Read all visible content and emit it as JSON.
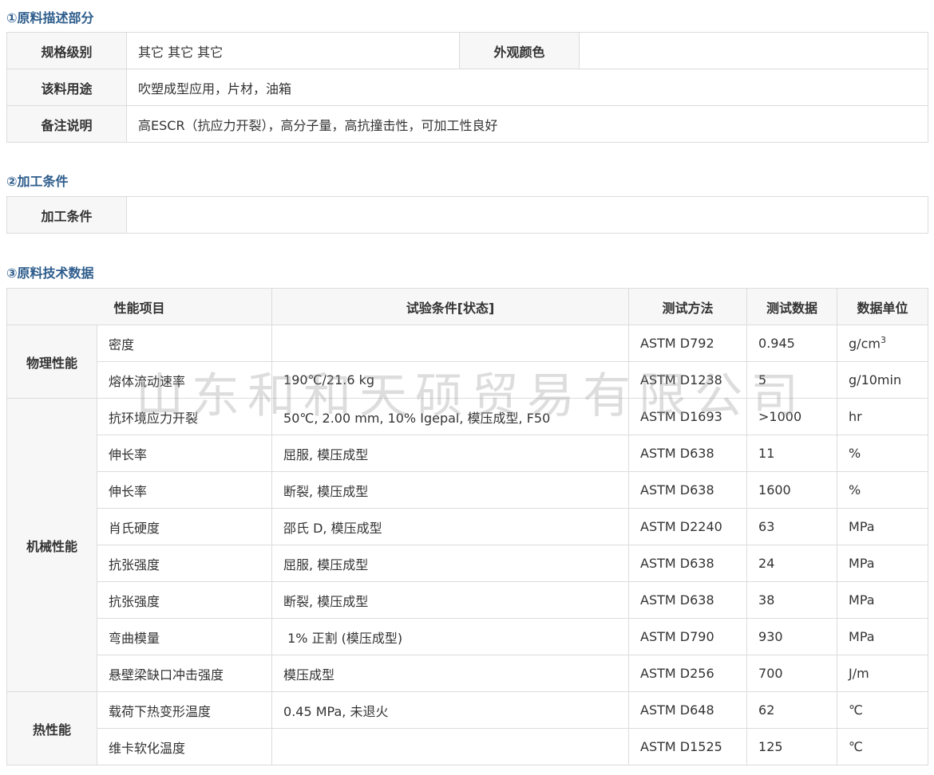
{
  "sections": {
    "desc_title": "①原料描述部分",
    "proc_title": "②加工条件",
    "tech_title": "③原料技术数据"
  },
  "desc_table": {
    "grade_label": "规格级别",
    "grade_value": "其它 其它 其它",
    "appearance_label": "外观颜色",
    "appearance_value": "",
    "usage_label": "该料用途",
    "usage_value": "吹塑成型应用，片材，油箱",
    "remarks_label": "备注说明",
    "remarks_value": "高ESCR（抗应力开裂），高分子量，高抗撞击性，可加工性良好"
  },
  "proc_table": {
    "label": "加工条件",
    "value": ""
  },
  "tech_table": {
    "headers": {
      "property": "性能项目",
      "condition": "试验条件[状态]",
      "method": "测试方法",
      "value": "测试数据",
      "unit": "数据单位"
    },
    "groups": {
      "physical": "物理性能",
      "mechanical": "机械性能",
      "thermal": "热性能"
    },
    "rows": [
      {
        "item": "密度",
        "condition": "",
        "method": "ASTM D792",
        "value": "0.945",
        "unit": "g/cm",
        "unit_sup": "3"
      },
      {
        "item": "熔体流动速率",
        "condition": "190℃/21.6 kg",
        "method": "ASTM D1238",
        "value": "5",
        "unit": "g/10min"
      },
      {
        "item": "抗环境应力开裂",
        "condition": "50℃, 2.00 mm, 10% Igepal, 模压成型, F50",
        "method": "ASTM D1693",
        "value": ">1000",
        "unit": "hr"
      },
      {
        "item": "伸长率",
        "condition": "屈服, 模压成型",
        "method": "ASTM D638",
        "value": "11",
        "unit": "%"
      },
      {
        "item": "伸长率",
        "condition": "断裂, 模压成型",
        "method": "ASTM D638",
        "value": "1600",
        "unit": "%"
      },
      {
        "item": "肖氏硬度",
        "condition": "邵氏 D, 模压成型",
        "method": "ASTM D2240",
        "value": "63",
        "unit": "MPa"
      },
      {
        "item": "抗张强度",
        "condition": "屈服, 模压成型",
        "method": "ASTM D638",
        "value": "24",
        "unit": "MPa"
      },
      {
        "item": "抗张强度",
        "condition": "断裂, 模压成型",
        "method": "ASTM D638",
        "value": "38",
        "unit": "MPa"
      },
      {
        "item": "弯曲模量",
        "condition": " 1% 正割 (模压成型)",
        "method": "ASTM D790",
        "value": "930",
        "unit": "MPa"
      },
      {
        "item": "悬壁梁缺口冲击强度",
        "condition": "模压成型",
        "method": "ASTM D256",
        "value": "700",
        "unit": "J/m"
      },
      {
        "item": "载荷下热变形温度",
        "condition": "0.45 MPa, 未退火",
        "method": "ASTM D648",
        "value": "62",
        "unit": "℃"
      },
      {
        "item": "维卡软化温度",
        "condition": "",
        "method": "ASTM D1525",
        "value": "125",
        "unit": "℃"
      }
    ]
  },
  "watermark": "山东和和天硕贸易有限公司"
}
